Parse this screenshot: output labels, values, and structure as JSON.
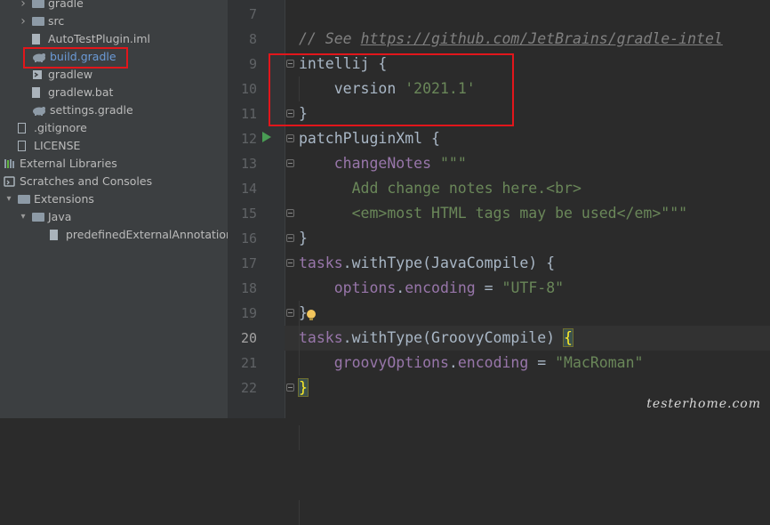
{
  "project_tree": [
    {
      "label": "gradle",
      "icon": "folder-icon",
      "indent": 36,
      "arrow": "chevron-right-icon"
    },
    {
      "label": "src",
      "icon": "folder-icon",
      "indent": 36,
      "arrow": "chevron-right-icon"
    },
    {
      "label": "AutoTestPlugin.iml",
      "icon": "iml-file-icon",
      "indent": 36
    },
    {
      "label": "build.gradle",
      "icon": "gradle-icon",
      "indent": 36,
      "selected": true
    },
    {
      "label": "gradlew",
      "icon": "script-file-icon",
      "indent": 36
    },
    {
      "label": "gradlew.bat",
      "icon": "bat-file-icon",
      "indent": 36
    },
    {
      "label": "settings.gradle",
      "icon": "gradle-icon",
      "indent": 36
    },
    {
      "label": ".gitignore",
      "icon": "gitignore-file-icon",
      "indent": 20
    },
    {
      "label": "LICENSE",
      "icon": "text-file-icon",
      "indent": 20
    },
    {
      "label": "External Libraries",
      "icon": "library-icon",
      "indent": 4,
      "arrow": "chevron-right-icon"
    },
    {
      "label": "Scratches and Consoles",
      "icon": "scratches-icon",
      "indent": 4,
      "arrow": "chevron-right-icon"
    },
    {
      "label": "Extensions",
      "icon": "folder-icon",
      "indent": 20,
      "arrow": "chevron-down-icon"
    },
    {
      "label": "Java",
      "icon": "folder-icon",
      "indent": 36,
      "arrow": "chevron-down-icon"
    },
    {
      "label": "predefinedExternalAnnotations.",
      "icon": "json-file-icon",
      "indent": 56
    }
  ],
  "editor": {
    "current_line": "20",
    "lines": [
      {
        "n": "7",
        "tokens": []
      },
      {
        "n": "8",
        "tokens": [
          {
            "t": "// See ",
            "c": "comment"
          },
          {
            "t": "https://github.com/JetBrains/gradle-intel",
            "c": "link"
          }
        ]
      },
      {
        "n": "9",
        "tokens": [
          {
            "t": "intellij {",
            "c": "plain"
          }
        ]
      },
      {
        "n": "10",
        "tokens": [
          {
            "t": "    version ",
            "c": "plain"
          },
          {
            "t": "'2021.1'",
            "c": "str"
          }
        ]
      },
      {
        "n": "11",
        "tokens": [
          {
            "t": "}",
            "c": "plain"
          }
        ]
      },
      {
        "n": "12",
        "tokens": [
          {
            "t": "patchPluginXml {",
            "c": "plain"
          }
        ]
      },
      {
        "n": "13",
        "tokens": [
          {
            "t": "    ",
            "c": "plain"
          },
          {
            "t": "changeNotes",
            "c": "prop"
          },
          {
            "t": " \"\"\"",
            "c": "str"
          }
        ]
      },
      {
        "n": "14",
        "tokens": [
          {
            "t": "      Add change notes here.<br>",
            "c": "str"
          }
        ]
      },
      {
        "n": "15",
        "tokens": [
          {
            "t": "      <em>most HTML tags may be used</em>\"\"\"",
            "c": "str"
          }
        ]
      },
      {
        "n": "16",
        "tokens": [
          {
            "t": "}",
            "c": "plain"
          }
        ]
      },
      {
        "n": "17",
        "tokens": [
          {
            "t": "tasks",
            "c": "prop"
          },
          {
            "t": ".withType(JavaCompile) {",
            "c": "plain"
          }
        ]
      },
      {
        "n": "18",
        "tokens": [
          {
            "t": "    ",
            "c": "plain"
          },
          {
            "t": "options",
            "c": "prop"
          },
          {
            "t": ".",
            "c": "plain"
          },
          {
            "t": "encoding",
            "c": "prop"
          },
          {
            "t": " = ",
            "c": "plain"
          },
          {
            "t": "\"UTF-8\"",
            "c": "str"
          }
        ]
      },
      {
        "n": "19",
        "tokens": [
          {
            "t": "}",
            "c": "plain"
          }
        ]
      },
      {
        "n": "20",
        "tokens": [
          {
            "t": "tasks",
            "c": "prop"
          },
          {
            "t": ".withType(GroovyCompile) ",
            "c": "plain"
          },
          {
            "t": "{",
            "c": "brace"
          }
        ]
      },
      {
        "n": "21",
        "tokens": [
          {
            "t": "    ",
            "c": "plain"
          },
          {
            "t": "groovyOptions",
            "c": "prop"
          },
          {
            "t": ".",
            "c": "plain"
          },
          {
            "t": "encoding",
            "c": "prop"
          },
          {
            "t": " = ",
            "c": "plain"
          },
          {
            "t": "\"MacRoman\"",
            "c": "str"
          }
        ]
      },
      {
        "n": "22",
        "tokens": [
          {
            "t": "}",
            "c": "brace"
          }
        ]
      }
    ]
  },
  "watermark": "testerhome.com",
  "colors": {
    "keyword": "#cc7832",
    "string": "#6a8759",
    "property": "#9876aa",
    "comment": "#808080",
    "annotation_box": "#e2161b"
  }
}
